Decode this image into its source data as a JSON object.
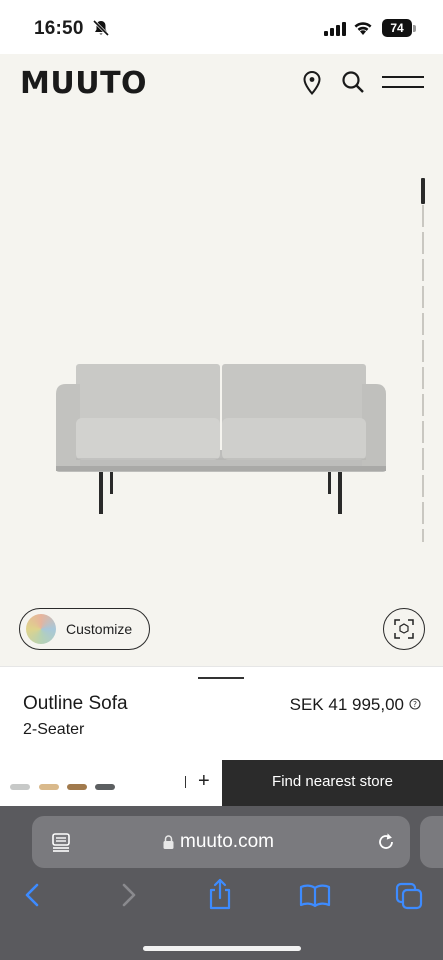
{
  "status": {
    "time": "16:50",
    "battery": "74"
  },
  "header": {
    "logo": "MUUTO",
    "location_icon": "location-pin-icon",
    "search_icon": "search-icon",
    "menu_icon": "menu-icon"
  },
  "gallery": {
    "customize_label": "Customize",
    "ar_icon": "ar-view-icon",
    "image_position": 1,
    "image_count": 12
  },
  "product": {
    "name": "Outline Sofa",
    "variant": "2-Seater",
    "price": "SEK 41 995,00"
  },
  "colors": {
    "swatches": [
      "#c7c9c8",
      "#d9b98b",
      "#a17a4d",
      "#5c5f61"
    ],
    "accent": "#2b2b2b",
    "background": "#f5f4ef"
  },
  "quantity": {
    "increment": "+"
  },
  "cta": {
    "find_store": "Find nearest store"
  },
  "browser": {
    "url": "muuto.com"
  }
}
